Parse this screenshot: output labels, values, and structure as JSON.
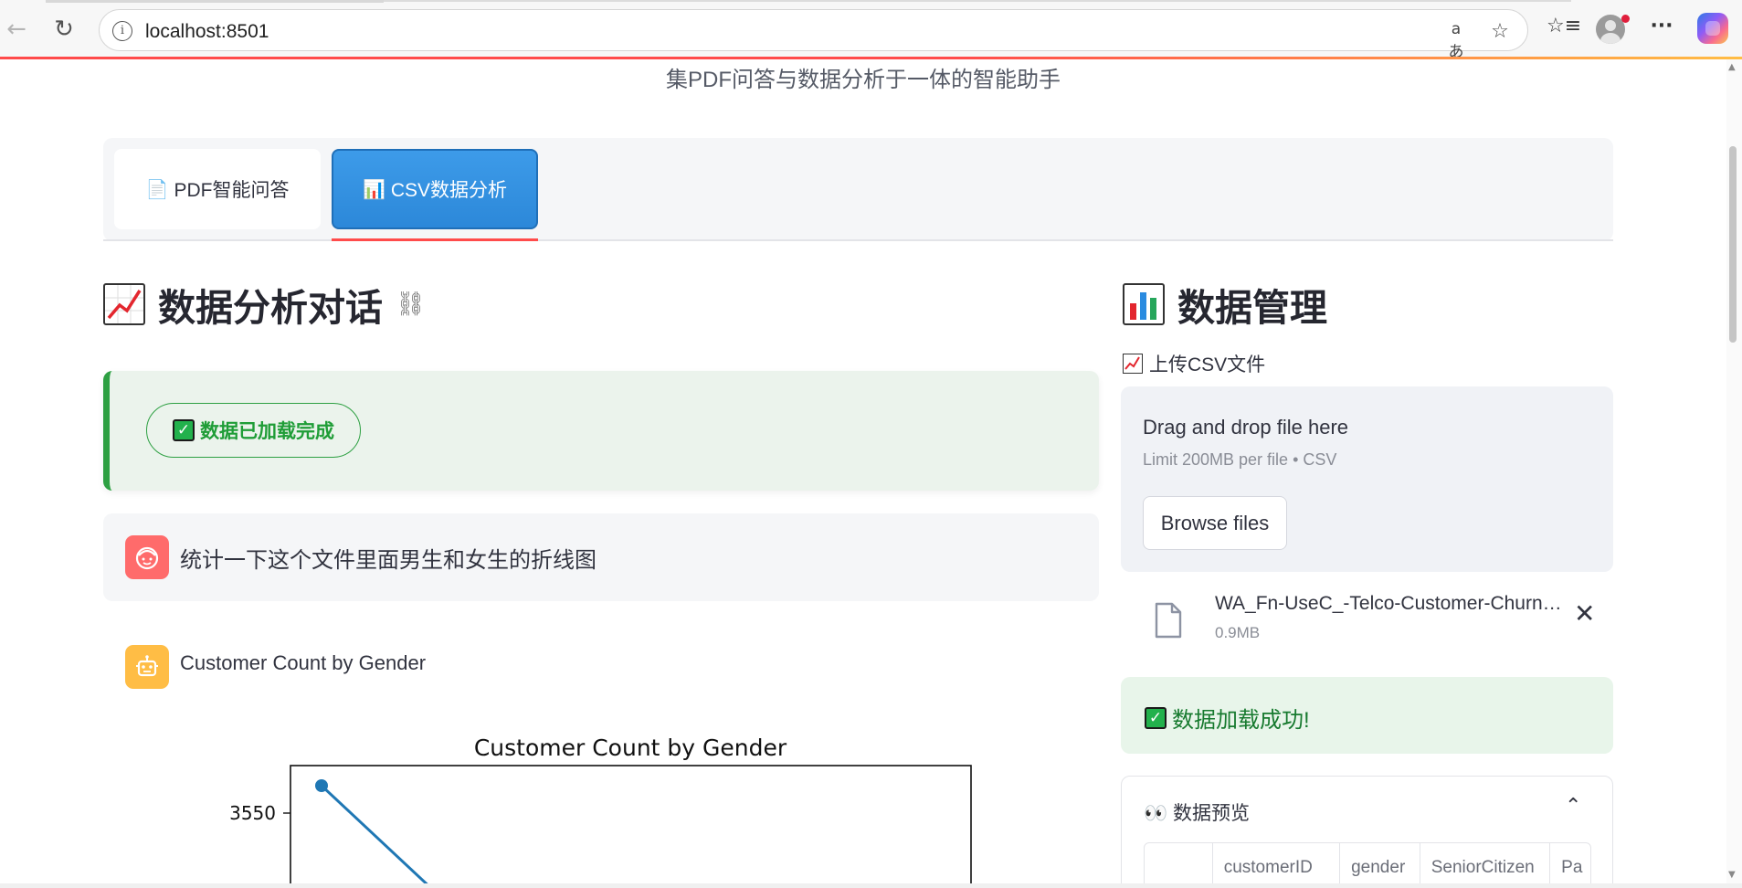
{
  "browser": {
    "url": "localhost:8501",
    "info_icon": "info-icon",
    "translate_label": "aあ"
  },
  "app": {
    "subtitle": "集PDF问答与数据分析于一体的智能助手"
  },
  "tabs": [
    {
      "label": "PDF智能问答",
      "icon": "📄"
    },
    {
      "label": "CSV数据分析",
      "icon": "📊"
    }
  ],
  "chat": {
    "title": "数据分析对话",
    "status_pill": "数据已加载完成",
    "user_message": "统计一下这个文件里面男生和女生的折线图",
    "assistant_message": "Customer Count by Gender"
  },
  "chart_data": {
    "type": "line",
    "title": "Customer Count by Gender",
    "ytick_visible": "3550",
    "series": [
      {
        "x": [
          0
        ],
        "y": [
          3555
        ]
      }
    ],
    "line_color": "#1f77b4"
  },
  "data_panel": {
    "title": "数据管理",
    "upload_label": "上传CSV文件",
    "dropzone_title": "Drag and drop file here",
    "dropzone_limit": "Limit 200MB per file • CSV",
    "browse_button": "Browse files",
    "file_name": "WA_Fn-UseC_-Telco-Customer-Churn.csv",
    "file_size": "0.9MB",
    "success_message": "数据加载成功!",
    "preview_title": "数据预览",
    "preview_icon": "👀",
    "columns": [
      "",
      "customerID",
      "gender",
      "SeniorCitizen",
      "Pa"
    ]
  },
  "colors": {
    "accent_red": "#ff4b4b",
    "tab_active_blue": "#2c88d9",
    "success_green": "#2ea043"
  }
}
